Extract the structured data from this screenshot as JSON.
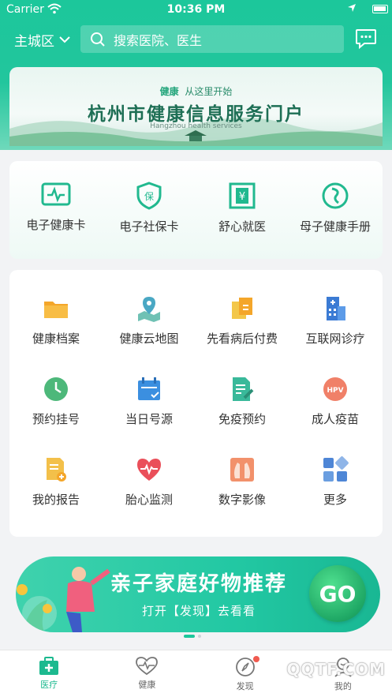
{
  "statusbar": {
    "carrier": "Carrier",
    "time": "10:36 PM"
  },
  "header": {
    "city": "主城区",
    "search_placeholder": "搜索医院、医生"
  },
  "banner": {
    "small_prefix": "健康",
    "small_text": "从这里开始",
    "title": "杭州市健康信息服务门户",
    "subtitle_en": "Hangzhou health services"
  },
  "quick": [
    {
      "label": "电子健康卡",
      "icon": "health-card-icon"
    },
    {
      "label": "电子社保卡",
      "icon": "social-security-icon"
    },
    {
      "label": "舒心就医",
      "icon": "payment-icon"
    },
    {
      "label": "母子健康手册",
      "icon": "mother-child-icon"
    }
  ],
  "grid": [
    {
      "label": "健康档案",
      "icon": "folder-icon"
    },
    {
      "label": "健康云地图",
      "icon": "map-icon"
    },
    {
      "label": "先看病后付费",
      "icon": "pay-later-icon"
    },
    {
      "label": "互联网诊疗",
      "icon": "hospital-icon"
    },
    {
      "label": "预约挂号",
      "icon": "clock-icon"
    },
    {
      "label": "当日号源",
      "icon": "calendar-icon"
    },
    {
      "label": "免疫预约",
      "icon": "vaccine-doc-icon"
    },
    {
      "label": "成人疫苗",
      "icon": "hpv-icon"
    },
    {
      "label": "我的报告",
      "icon": "report-icon"
    },
    {
      "label": "胎心监测",
      "icon": "heart-monitor-icon"
    },
    {
      "label": "数字影像",
      "icon": "xray-icon"
    },
    {
      "label": "更多",
      "icon": "more-icon"
    }
  ],
  "promo": {
    "title": "亲子家庭好物推荐",
    "subtitle": "打开【发现】去看看",
    "go": "GO"
  },
  "tabs": [
    {
      "label": "医疗",
      "active": true
    },
    {
      "label": "健康",
      "active": false
    },
    {
      "label": "发现",
      "active": false
    },
    {
      "label": "我的",
      "active": false
    }
  ],
  "watermark": "QQTF.COM"
}
